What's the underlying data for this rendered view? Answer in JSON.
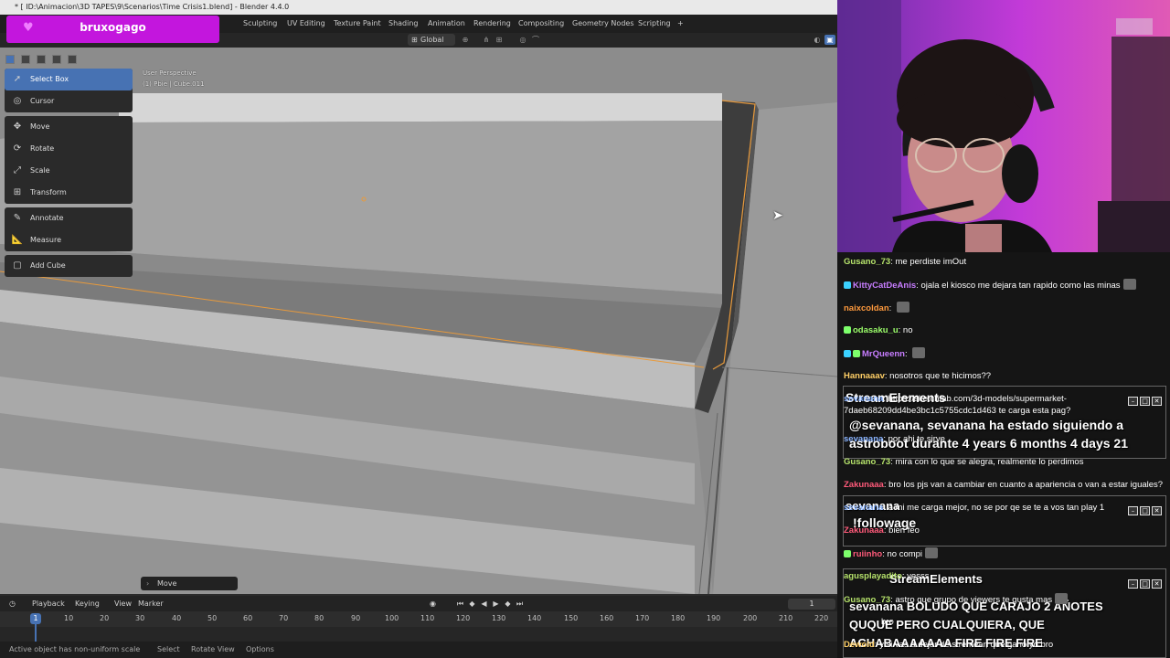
{
  "window": {
    "title": "* [ ID:\\Animacion\\3D TAPES\\9\\Scenarios\\Time Crisis1.blend] - Blender 4.4.0"
  },
  "workspaces": [
    "Sculpting",
    "UV Editing",
    "Texture Paint",
    "Shading",
    "Animation",
    "Rendering",
    "Compositing",
    "Geometry Nodes",
    "Scripting",
    "+"
  ],
  "header": {
    "orientation": "Global"
  },
  "viewport": {
    "perspective": "User Perspective",
    "collection": "(1) Pbie | Cube.011"
  },
  "tools": {
    "group1": [
      {
        "label": "Select Box",
        "icon": "select-box-icon",
        "active": true
      },
      {
        "label": "Cursor",
        "icon": "cursor-icon"
      }
    ],
    "group2": [
      {
        "label": "Move",
        "icon": "move-icon"
      },
      {
        "label": "Rotate",
        "icon": "rotate-icon"
      },
      {
        "label": "Scale",
        "icon": "scale-icon"
      },
      {
        "label": "Transform",
        "icon": "transform-icon"
      }
    ],
    "group3": [
      {
        "label": "Annotate",
        "icon": "annotate-icon"
      },
      {
        "label": "Measure",
        "icon": "measure-icon"
      }
    ],
    "group4": [
      {
        "label": "Add Cube",
        "icon": "add-cube-icon"
      }
    ]
  },
  "last_operator": "Move",
  "timeline": {
    "menus": [
      "Playback",
      "Keying",
      "View",
      "Marker"
    ],
    "current_frame": "1",
    "playhead_label": "1",
    "ticks": [
      "10",
      "20",
      "30",
      "40",
      "50",
      "60",
      "70",
      "80",
      "90",
      "100",
      "110",
      "120",
      "130",
      "140",
      "150",
      "160",
      "170",
      "180",
      "190",
      "200",
      "210",
      "220"
    ]
  },
  "statusbar": {
    "warning": "Active object has non-uniform scale",
    "select": "Select",
    "rotate": "Rotate View",
    "options": "Options"
  },
  "stream": {
    "name": "bruxogago"
  },
  "chat": {
    "messages": [
      {
        "user": "Gusano_73",
        "color": "#b6e36b",
        "text": "me perdiste imOut"
      },
      {
        "user": "KittyCatDeAnis",
        "color": "#c77dff",
        "text": "ojala el kiosco me dejara tan rapido como las minas"
      },
      {
        "user": "naixcoldan",
        "color": "#ff9a3d",
        "text": ""
      },
      {
        "user": "odasaku_u",
        "color": "#9cff6b",
        "text": "no"
      },
      {
        "user": "MrQueenn",
        "color": "#c77dff",
        "text": ""
      },
      {
        "user": "Hannaaav",
        "color": "#ffcf66",
        "text": "nosotros que te hicimos??"
      },
      {
        "user": "sevanana",
        "color": "#8ab4ff",
        "text": "https://sketchfab.com/3d-models/supermarket-7daeb68209dd4be3bc1c5755cdc1d463 te carga esta pag?"
      },
      {
        "user": "sevanana",
        "color": "#8ab4ff",
        "text": "por ahi te sirve"
      },
      {
        "user": "Gusano_73",
        "color": "#b6e36b",
        "text": "mira con lo que se alegra, realmente lo perdimos"
      },
      {
        "user": "Zakunaaa",
        "color": "#ff5a7a",
        "text": "bro los pjs van a cambiar en cuanto a apariencia o van a estar iguales?"
      },
      {
        "user": "sevanana",
        "color": "#8ab4ff",
        "text": "a mi me carga mejor, no se por qe se te a vos tan play 1"
      },
      {
        "user": "Zakunaaa",
        "color": "#ff5a7a",
        "text": "bien feo"
      },
      {
        "user": "ruiinho",
        "color": "#ff5a7a",
        "text": "no compi"
      },
      {
        "user": "agusplayadito",
        "color": "#b6e36b",
        "text": "yesss"
      },
      {
        "user": "Gusano_73",
        "color": "#b6e36b",
        "text": "astro que grupo de viewers te gusta mas"
      },
      {
        "user": "",
        "color": "#ffffff",
        "text": "bro"
      },
      {
        "user": "Dewold",
        "color": "#ffcf66",
        "text": "y si vas a dejar de stremear, que gano yo bro"
      }
    ],
    "alerts": {
      "title1": "StreamElements",
      "follow_text1": "@sevanana, sevanana ha estado siguiendo a",
      "follow_text2": "astroboot durante 4 years 6 months 4 days 21",
      "title2": "sevanana",
      "cmd": "!followage",
      "title3": "StreamElements",
      "tts1": "sevanana BOLUDO QUE CARAJO 2 AÑOTES",
      "tts2": "QUQUE PERO CUALQUIERA, QUE",
      "tts3": "ACHABAAAAAAA FIRE FIRE FIRE"
    }
  }
}
